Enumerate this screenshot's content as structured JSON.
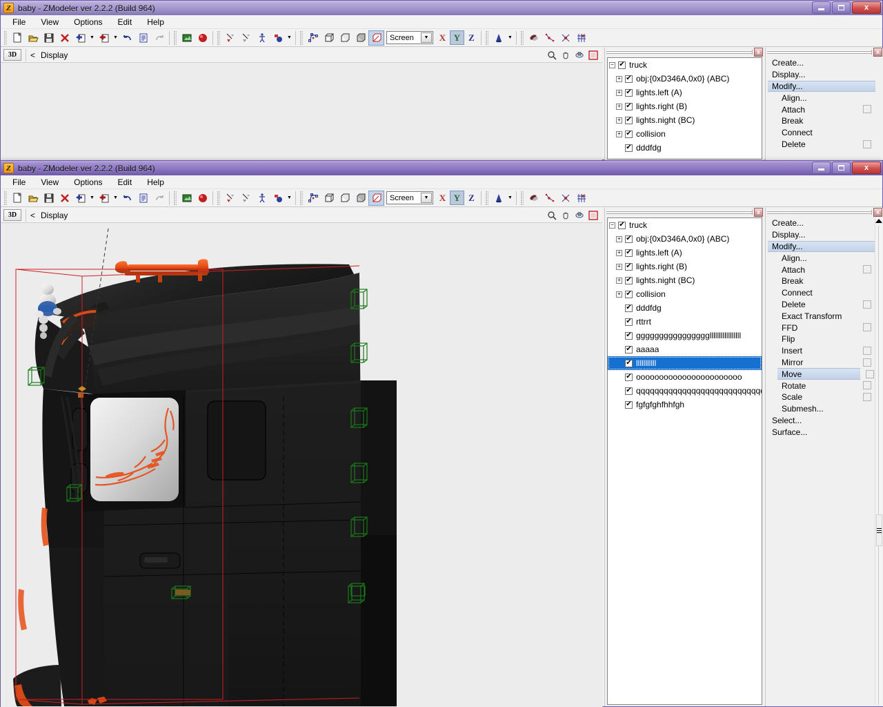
{
  "app": {
    "title": "baby - ZModeler ver 2.2.2 (Build 964)",
    "icon_letter": "Z"
  },
  "menu": {
    "items": [
      {
        "label": "File"
      },
      {
        "label": "View"
      },
      {
        "label": "Options"
      },
      {
        "label": "Edit"
      },
      {
        "label": "Help"
      }
    ]
  },
  "toolbar": {
    "icons_group1": [
      "new-file-icon",
      "open-folder-icon",
      "save-disk-icon",
      "delete-x-icon",
      "import-icon",
      "export-icon",
      "undo-icon",
      "properties-icon",
      "redo-icon"
    ],
    "icons_group2": [
      "render-icon",
      "sphere-icon"
    ],
    "icons_group3": [
      "vertex-select-icon",
      "face-select-icon",
      "object-select-icon",
      "material-select-icon"
    ],
    "icons_group4": [
      "polygon-mode-icon",
      "cube-wire-icon",
      "cube-solid-icon",
      "cube-shade-icon",
      "cube-textured-icon"
    ],
    "icons_group5": [
      "cone-icon"
    ],
    "icons_group6": [
      "uv-mapping-icon",
      "weld-icon",
      "split-icon",
      "grid-snap-icon"
    ],
    "coordinate_system": "Screen",
    "axis_x": "X",
    "axis_y": "Y",
    "axis_z": "Z",
    "axis_active": "Y"
  },
  "viewport": {
    "mode_button": "3D",
    "back_arrow": "<",
    "label": "Display",
    "tools": [
      "zoom-icon",
      "pan-hand-icon",
      "orbit-icon",
      "maximize-viewport-icon"
    ],
    "background_color": "#ececec"
  },
  "tree_panel": {
    "close_label": "x",
    "items": [
      {
        "label": "truck",
        "depth": 0,
        "expander": "minus",
        "checked": true
      },
      {
        "label": "obj:{0xD346A,0x0} (ABC)",
        "depth": 1,
        "expander": "plus",
        "checked": true
      },
      {
        "label": "lights.left (A)",
        "depth": 1,
        "expander": "plus",
        "checked": true
      },
      {
        "label": "lights.right (B)",
        "depth": 1,
        "expander": "plus",
        "checked": true
      },
      {
        "label": "lights.night (BC)",
        "depth": 1,
        "expander": "plus",
        "checked": true
      },
      {
        "label": "collision",
        "depth": 1,
        "expander": "plus",
        "checked": true
      },
      {
        "label": "dddfdg",
        "depth": 1,
        "expander": "none",
        "checked": true
      },
      {
        "label": "rttrrt",
        "depth": 1,
        "expander": "none",
        "checked": true
      },
      {
        "label": "gggggggggggggggglllllllllllllllll",
        "depth": 1,
        "expander": "none",
        "checked": true
      },
      {
        "label": "aaaaa",
        "depth": 1,
        "expander": "none",
        "checked": true
      },
      {
        "label": "lllllllllll",
        "depth": 1,
        "expander": "none",
        "checked": true,
        "selected": true
      },
      {
        "label": "ooooooooooooooooooooooo",
        "depth": 1,
        "expander": "none",
        "checked": true
      },
      {
        "label": "qqqqqqqqqqqqqqqqqqqqqqqqqqqqqqqqq",
        "depth": 1,
        "expander": "none",
        "checked": true
      },
      {
        "label": "fgfgfghfhhfgh",
        "depth": 1,
        "expander": "none",
        "checked": true
      }
    ],
    "visible_count_back_window": 7
  },
  "command_panel": {
    "close_label": "x",
    "items": [
      {
        "label": "Create...",
        "level": 1,
        "option_box": false
      },
      {
        "label": "Display...",
        "level": 1,
        "option_box": false
      },
      {
        "label": "Modify...",
        "level": 1,
        "option_box": false,
        "highlighted": true
      },
      {
        "label": "Align...",
        "level": 2,
        "option_box": false
      },
      {
        "label": "Attach",
        "level": 2,
        "option_box": true
      },
      {
        "label": "Break",
        "level": 2,
        "option_box": false
      },
      {
        "label": "Connect",
        "level": 2,
        "option_box": false
      },
      {
        "label": "Delete",
        "level": 2,
        "option_box": true
      },
      {
        "label": "Exact Transform",
        "level": 2,
        "option_box": false
      },
      {
        "label": "FFD",
        "level": 2,
        "option_box": true
      },
      {
        "label": "Flip",
        "level": 2,
        "option_box": false
      },
      {
        "label": "Insert",
        "level": 2,
        "option_box": true
      },
      {
        "label": "Mirror",
        "level": 2,
        "option_box": true
      },
      {
        "label": "Move",
        "level": 2,
        "option_box": true,
        "selected": true
      },
      {
        "label": "Rotate",
        "level": 2,
        "option_box": true
      },
      {
        "label": "Scale",
        "level": 2,
        "option_box": true
      },
      {
        "label": "Submesh...",
        "level": 2,
        "option_box": false
      },
      {
        "label": "Select...",
        "level": 1,
        "option_box": false
      },
      {
        "label": "Surface...",
        "level": 1,
        "option_box": false
      }
    ],
    "back_window_visible_items": 8
  },
  "window_controls": {
    "minimize": "minimize-button",
    "maximize": "maximize-button",
    "close": "close-button",
    "close_glyph": "x"
  },
  "colors": {
    "accent_orange": "#e8501a",
    "selection_blue": "#1670d0",
    "highlight_gray": "#c9d6e8",
    "viewport_bg": "#ececec",
    "body_black": "#1c1c1c",
    "gizmo_green": "#1a7a1a",
    "bounding_red": "#d02020",
    "titlebar_purple": "#8e79c2"
  },
  "scene": {
    "description": "3D side view of a black DAF truck cab with orange air-horns on the roof, orange trim, a Michelin-man figurine, a mirrored side window with orange graphic decals, red bounding box and green dummy-object gizmos.",
    "object_name": "truck"
  }
}
